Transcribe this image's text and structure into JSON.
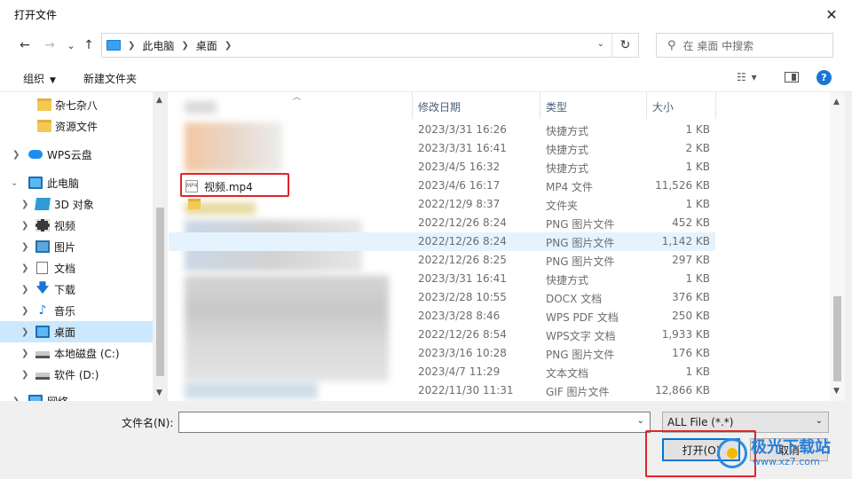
{
  "window": {
    "title": "打开文件",
    "close": "✕"
  },
  "navbar": {
    "back": "←",
    "forward": "→",
    "recent": "⌄",
    "up": "↑",
    "breadcrumb": [
      "此电脑",
      "桌面"
    ],
    "refresh": "↻",
    "search_placeholder": "在 桌面 中搜索"
  },
  "toolbar": {
    "organize": "组织",
    "new_folder": "新建文件夹"
  },
  "sidebar": {
    "items": [
      {
        "label": "杂七杂八",
        "icon": "folder-icon"
      },
      {
        "label": "资源文件",
        "icon": "folder-icon"
      },
      {
        "label": "WPS云盘",
        "icon": "cloud-icon"
      },
      {
        "label": "此电脑",
        "icon": "computer-icon"
      },
      {
        "label": "3D 对象",
        "icon": "cube-icon"
      },
      {
        "label": "视频",
        "icon": "video-icon"
      },
      {
        "label": "图片",
        "icon": "pictures-icon"
      },
      {
        "label": "文档",
        "icon": "documents-icon"
      },
      {
        "label": "下载",
        "icon": "download-icon"
      },
      {
        "label": "音乐",
        "icon": "music-icon"
      },
      {
        "label": "桌面",
        "icon": "desktop-icon",
        "selected": true
      },
      {
        "label": "本地磁盘 (C:)",
        "icon": "drive-icon"
      },
      {
        "label": "软件 (D:)",
        "icon": "drive-icon"
      },
      {
        "label": "网络",
        "icon": "network-icon"
      }
    ]
  },
  "columns": {
    "name": "",
    "date": "修改日期",
    "type": "类型",
    "size": "大小"
  },
  "files": [
    {
      "name": "",
      "date": "2023/3/31 16:26",
      "type": "快捷方式",
      "size": "1 KB"
    },
    {
      "name": "",
      "date": "2023/3/31 16:41",
      "type": "快捷方式",
      "size": "2 KB"
    },
    {
      "name": "",
      "date": "2023/4/5 16:32",
      "type": "快捷方式",
      "size": "1 KB"
    },
    {
      "name": "视频.mp4",
      "date": "2023/4/6 16:17",
      "type": "MP4 文件",
      "size": "11,526 KB"
    },
    {
      "name": "",
      "date": "2022/12/9 8:37",
      "type": "文件夹",
      "size": "1 KB"
    },
    {
      "name": "",
      "date": "2022/12/26 8:24",
      "type": "PNG 图片文件",
      "size": "452 KB"
    },
    {
      "name": "",
      "date": "2022/12/26 8:24",
      "type": "PNG 图片文件",
      "size": "1,142 KB"
    },
    {
      "name": "",
      "date": "2022/12/26 8:25",
      "type": "PNG 图片文件",
      "size": "297 KB"
    },
    {
      "name": "",
      "date": "2023/3/31 16:41",
      "type": "快捷方式",
      "size": "1 KB"
    },
    {
      "name": "",
      "date": "2023/2/28 10:55",
      "type": "DOCX 文档",
      "size": "376 KB"
    },
    {
      "name": "",
      "date": "2023/3/28 8:46",
      "type": "WPS PDF 文档",
      "size": "250 KB"
    },
    {
      "name": "",
      "date": "2022/12/26 8:54",
      "type": "WPS文字 文档",
      "size": "1,933 KB"
    },
    {
      "name": "",
      "date": "2023/3/16 10:28",
      "type": "PNG 图片文件",
      "size": "176 KB"
    },
    {
      "name": "",
      "date": "2023/4/7 11:29",
      "type": "文本文档",
      "size": "1 KB"
    },
    {
      "name": "",
      "date": "2022/11/30 11:31",
      "type": "GIF 图片文件",
      "size": "12,866 KB"
    }
  ],
  "footer": {
    "filename_label": "文件名(N):",
    "filename_value": "",
    "filetype": "ALL File (*.*)",
    "open": "打开(O)",
    "cancel": "取消"
  },
  "watermark": {
    "brand": "极光下载站",
    "url": "www.xz7.com"
  },
  "colors": {
    "accent": "#0078d7",
    "selection": "#cce8ff",
    "highlight_box": "#e0242b"
  }
}
